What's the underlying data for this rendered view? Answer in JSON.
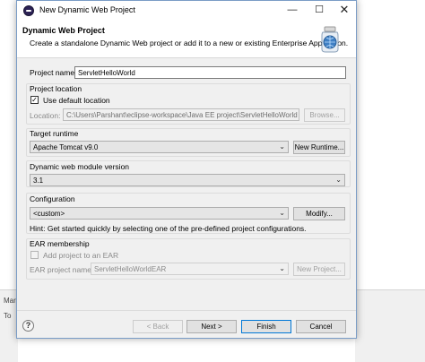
{
  "window": {
    "title": "New Dynamic Web Project"
  },
  "header": {
    "title": "Dynamic Web Project",
    "description": "Create a standalone Dynamic Web project or add it to a new or existing Enterprise Application."
  },
  "project_name": {
    "label": "Project name:",
    "value": "ServletHelloWorld"
  },
  "project_location": {
    "group_label": "Project location",
    "use_default_label": "Use default location",
    "use_default_checked": true,
    "location_label": "Location:",
    "location_value": "C:\\Users\\Parshant\\eclipse-workspace\\Java EE project\\ServletHelloWorld",
    "browse_label": "Browse..."
  },
  "target_runtime": {
    "group_label": "Target runtime",
    "selected": "Apache Tomcat v9.0",
    "new_runtime_label": "New Runtime..."
  },
  "module_version": {
    "group_label": "Dynamic web module version",
    "selected": "3.1"
  },
  "configuration": {
    "group_label": "Configuration",
    "selected": "<custom>",
    "modify_label": "Modify...",
    "hint": "Hint: Get started quickly by selecting one of the pre-defined project configurations."
  },
  "ear": {
    "group_label": "EAR membership",
    "add_label": "Add project to an EAR",
    "add_checked": false,
    "project_name_label": "EAR project name:",
    "project_name_value": "ServletHelloWorldEAR",
    "new_project_label": "New Project..."
  },
  "footer": {
    "back_label": "< Back",
    "next_label": "Next >",
    "finish_label": "Finish",
    "cancel_label": "Cancel"
  },
  "background": {
    "mark_label": "Mark",
    "item_label": "To"
  }
}
